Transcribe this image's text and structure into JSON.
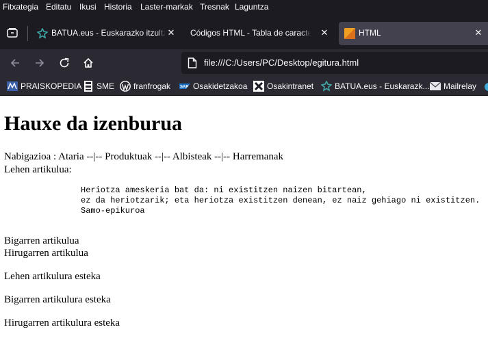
{
  "menubar": {
    "items": [
      "Fitxategia",
      "Editatu",
      "Ikusi",
      "Historia",
      "Laster-markak",
      "Tresnak",
      "Laguntza"
    ]
  },
  "tabs": [
    {
      "title": "BATUA.eus - Euskarazko itzultzailea",
      "icon": "batua-favicon",
      "active": false
    },
    {
      "title": "Códigos HTML - Tabla de caracteres",
      "icon": "none",
      "active": false
    },
    {
      "title": "HTML",
      "icon": "orange-favicon",
      "active": true
    }
  ],
  "toolbar": {
    "url": "file:///C:/Users/PC/Desktop/egitura.html"
  },
  "bookmarks": [
    {
      "label": "PRAISKOPEDIA",
      "icon": "praiskopedia-icon"
    },
    {
      "label": "SME",
      "icon": "sme-icon"
    },
    {
      "label": "franfrogak",
      "icon": "wordpress-icon"
    },
    {
      "label": "Osakidetzakoa",
      "icon": "sap-icon"
    },
    {
      "label": "Osakintranet",
      "icon": "osakintranet-icon"
    },
    {
      "label": "BATUA.eus - Euskarazk...",
      "icon": "batua-favicon"
    },
    {
      "label": "Mailrelay",
      "icon": "mail-icon"
    }
  ],
  "colors": {
    "chrome_dark": "#1c1b22",
    "chrome_toolbar": "#2b2a33",
    "active_tab": "#42414d",
    "batua_teal": "#3fa7a6"
  },
  "page": {
    "heading": "Hauxe da izenburua",
    "nav": "Nabigazioa : Ataria --|-- Produktuak --|-- Albisteak --|-- Harremanak",
    "first_article": "Lehen artikulua:",
    "quote_lines": [
      "Heriotza ameskeria bat da: ni existitzen naizen bitartean,",
      "ez da heriotzarik; eta heriotza existitzen denean, ez naiz gehiago ni existitzen.",
      "Samo-epikuroa"
    ],
    "second_article": "Bigarren artikulua",
    "third_article": "Hirugarren artikulua",
    "links": [
      "Lehen artikulura esteka",
      "Bigarren artikulura esteka",
      "Hirugarren artikulura esteka"
    ]
  }
}
